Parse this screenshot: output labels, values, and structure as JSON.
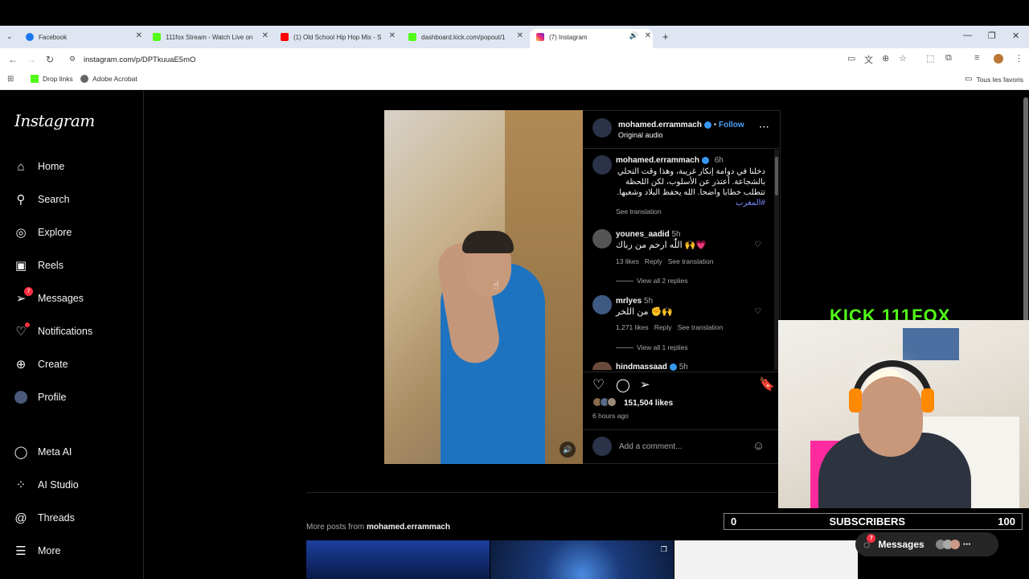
{
  "browser": {
    "tabs": [
      {
        "title": "Facebook",
        "color": "#1877f2"
      },
      {
        "title": "111fox Stream - Watch Live on",
        "color": "#53fc18"
      },
      {
        "title": "(1) Old School Hip Hop Mix - S",
        "color": "#ff0000"
      },
      {
        "title": "dashboard.kick.com/popout/1",
        "color": "#53fc18"
      },
      {
        "title": "(7) Instagram",
        "color": "#e1306c"
      }
    ],
    "url": "instagram.com/p/DPTkuuaE5mO",
    "bookmarks": [
      "Drop links",
      "Adobe Acrobat"
    ],
    "bookmarks_right": "Tous les favoris"
  },
  "sidebar": {
    "logo": "Instagram",
    "items": [
      {
        "label": "Home",
        "icon": "⌂"
      },
      {
        "label": "Search",
        "icon": "⚲"
      },
      {
        "label": "Explore",
        "icon": "◎"
      },
      {
        "label": "Reels",
        "icon": "▣"
      },
      {
        "label": "Messages",
        "icon": "➢",
        "badge": "7"
      },
      {
        "label": "Notifications",
        "icon": "♡"
      },
      {
        "label": "Create",
        "icon": "⊕"
      },
      {
        "label": "Profile",
        "icon": "●"
      },
      {
        "label": "Meta AI",
        "icon": "◯"
      },
      {
        "label": "AI Studio",
        "icon": "⁘"
      },
      {
        "label": "Threads",
        "icon": "@"
      },
      {
        "label": "More",
        "icon": "☰"
      }
    ]
  },
  "post": {
    "author": "mohamed.errammach",
    "follow": "Follow",
    "audio": "Original audio",
    "caption_time": "6h",
    "caption": "دخلنا في دوامة إنكار غريبة، وهذا وقت التحلي بالشجاعة. أعتذر عن الأسلوب، لكن اللحظة تتطلب خطابا واضحا. الله يحفظ البلاد وشعبها.",
    "caption_tag": "#المغرب",
    "see_translation": "See translation",
    "comments": [
      {
        "user": "younes_aadid",
        "time": "5h",
        "text": "اللّٰه ارحم من رباك 🙌💗",
        "likes": "13 likes",
        "reply": "Reply",
        "translate": "See translation",
        "replies": "View all 2 replies"
      },
      {
        "user": "mrlyes",
        "time": "5h",
        "text": "من اللخر ✊🙌",
        "likes": "1,271 likes",
        "reply": "Reply",
        "translate": "See translation",
        "replies": "View all 1 replies"
      },
      {
        "user": "hindmassaad",
        "time": "5h"
      }
    ],
    "likes": "151,504 likes",
    "posted": "6 hours ago",
    "add_comment": "Add a comment..."
  },
  "overlay": {
    "kick_logo": "KICK 111FOX",
    "sub_left": "0",
    "sub_label": "SUBSCRIBERS",
    "sub_right": "100"
  },
  "more_posts": {
    "prefix": "More posts from",
    "author": "mohamed.errammach"
  },
  "messages_pill": {
    "label": "Messages",
    "badge": "7"
  }
}
